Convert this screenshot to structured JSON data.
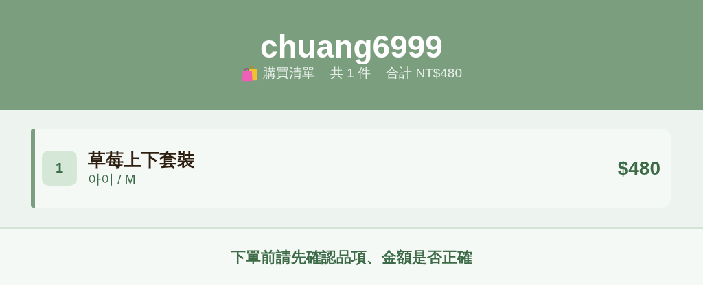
{
  "header": {
    "title": "chuang6999",
    "list_label": "購買清單",
    "count": "共 1 件",
    "total": "合計 NT$480"
  },
  "items": [
    {
      "index": "1",
      "name": "草莓上下套裝",
      "variant": "아이 / M",
      "price": "$480"
    }
  ],
  "footer": {
    "note": "下單前請先確認品項、金額是否正確"
  }
}
